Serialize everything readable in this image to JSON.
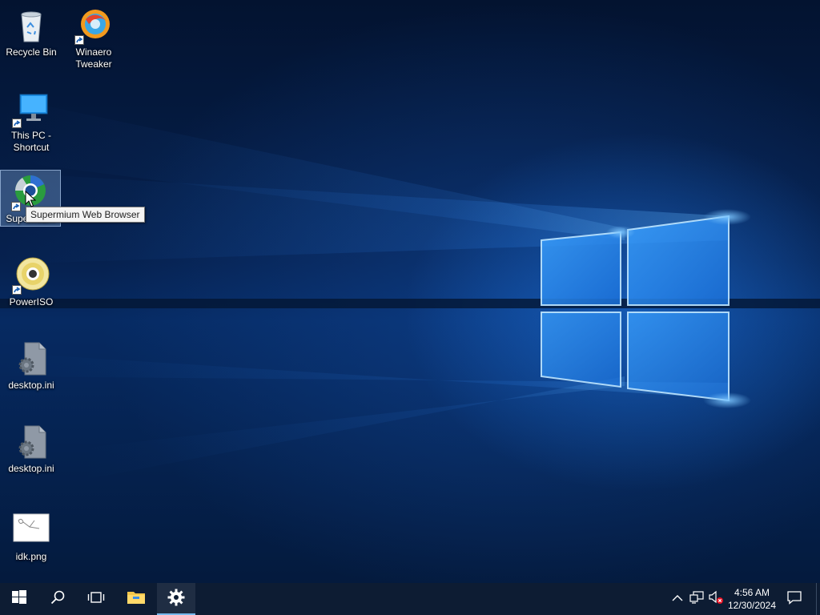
{
  "desktop": {
    "icons": [
      {
        "label": "Recycle Bin",
        "icon": "recycle-bin-icon"
      },
      {
        "label": "Winaero Tweaker",
        "icon": "winaero-tweaker-icon"
      },
      {
        "label": "This PC - Shortcut",
        "icon": "this-pc-icon"
      },
      {
        "label": "Supermium",
        "icon": "supermium-icon"
      },
      {
        "label": "PowerISO",
        "icon": "poweriso-icon"
      },
      {
        "label": "desktop.ini",
        "icon": "settings-file-icon"
      },
      {
        "label": "desktop.ini",
        "icon": "settings-file-icon"
      },
      {
        "label": "idk.png",
        "icon": "image-file-icon"
      }
    ],
    "tooltip": "Supermium Web Browser"
  },
  "taskbar": {
    "buttons": [
      {
        "name": "start",
        "icon": "windows-logo-icon"
      },
      {
        "name": "search",
        "icon": "search-icon"
      },
      {
        "name": "task-view",
        "icon": "task-view-icon"
      },
      {
        "name": "file-explorer",
        "icon": "folder-icon"
      },
      {
        "name": "settings",
        "icon": "gear-icon",
        "active": true
      }
    ],
    "tray": {
      "icons": [
        "chevron-up-icon",
        "network-icon",
        "volume-muted-icon"
      ],
      "time": "4:56 AM",
      "date": "12/30/2024",
      "notification_icon": "action-center-icon"
    }
  },
  "colors": {
    "taskbar": "#0d1c33",
    "accent": "#76b9ed",
    "wallpaper_light": "#3f9dff"
  }
}
